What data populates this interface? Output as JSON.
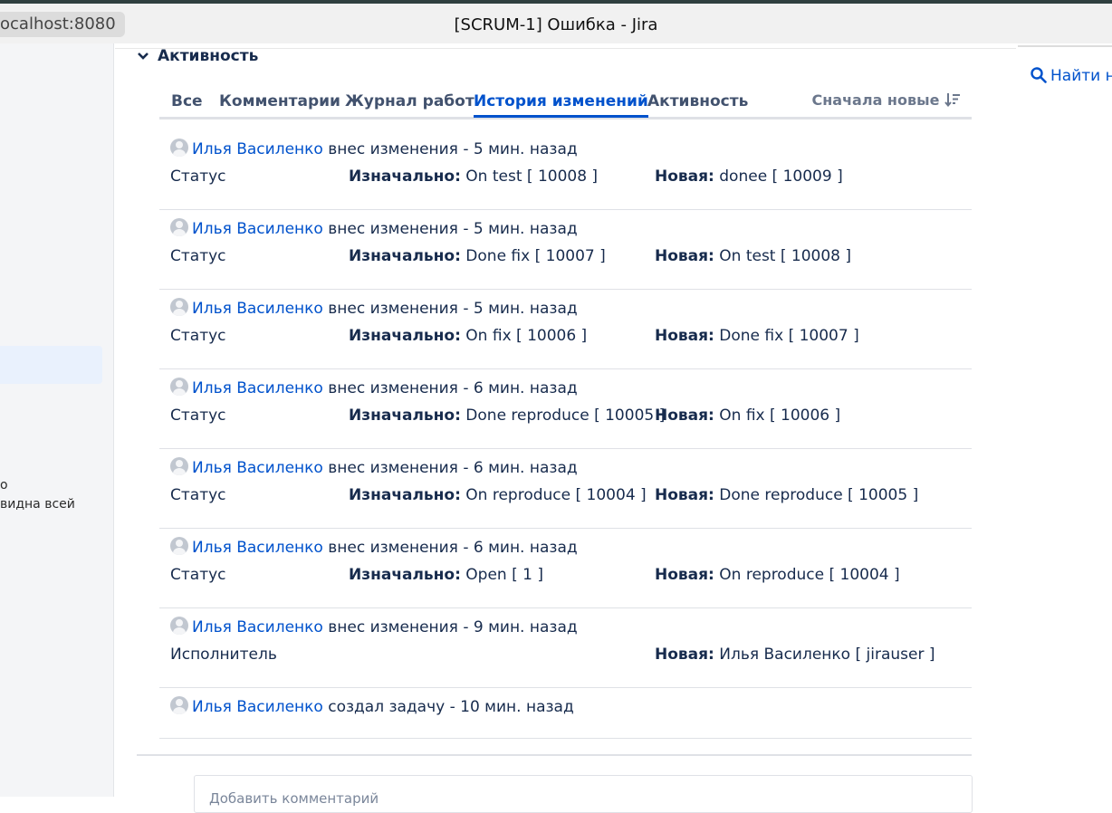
{
  "browser": {
    "url": "ocalhost:8080",
    "window_title": "[SCRUM-1] Ошибка - Jira"
  },
  "sidebar": {
    "text_line1": "о",
    "text_line2": "видна всей"
  },
  "right_panel": {
    "search_label": "Найти на"
  },
  "activity": {
    "header": "Активность",
    "tabs": [
      "Все",
      "Комментарии",
      "Журнал работ",
      "История изменений",
      "Активность"
    ],
    "active_tab": "История изменений",
    "sort_label": "Сначала новые",
    "original_label": "Изначально:",
    "new_label": "Новая:",
    "entries": [
      {
        "user": "Илья Василенко",
        "action": "внес изменения - 5 мин. назад",
        "field": "Статус",
        "original": "On test [ 10008 ]",
        "new": "donee [ 10009 ]"
      },
      {
        "user": "Илья Василенко",
        "action": "внес изменения - 5 мин. назад",
        "field": "Статус",
        "original": "Done fix [ 10007 ]",
        "new": "On test [ 10008 ]"
      },
      {
        "user": "Илья Василенко",
        "action": "внес изменения - 5 мин. назад",
        "field": "Статус",
        "original": "On fix [ 10006 ]",
        "new": "Done fix [ 10007 ]"
      },
      {
        "user": "Илья Василенко",
        "action": "внес изменения - 6 мин. назад",
        "field": "Статус",
        "original": "Done reproduce [ 10005 ]",
        "new": "On fix [ 10006 ]"
      },
      {
        "user": "Илья Василенко",
        "action": "внес изменения - 6 мин. назад",
        "field": "Статус",
        "original": "On reproduce [ 10004 ]",
        "new": "Done reproduce [ 10005 ]"
      },
      {
        "user": "Илья Василенко",
        "action": "внес изменения - 6 мин. назад",
        "field": "Статус",
        "original": "Open [ 1 ]",
        "new": "On reproduce [ 10004 ]"
      },
      {
        "user": "Илья Василенко",
        "action": "внес изменения - 9 мин. назад",
        "field": "Исполнитель",
        "original": "",
        "new": "Илья Василенко [ jirauser ]"
      },
      {
        "user": "Илья Василенко",
        "action": "создал задачу - 10 мин. назад",
        "field": "",
        "original": "",
        "new": ""
      }
    ]
  },
  "comment": {
    "placeholder": "Добавить комментарий"
  },
  "colors": {
    "link": "#0052cc",
    "text": "#172b4d",
    "divider": "#dfe1e6"
  }
}
